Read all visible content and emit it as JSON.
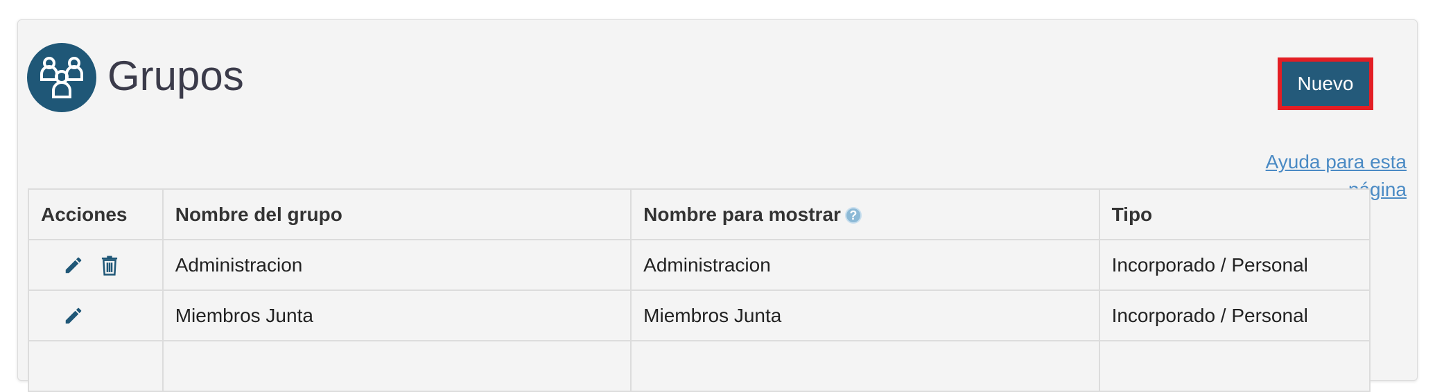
{
  "header": {
    "title": "Grupos",
    "icon": "group-icon",
    "accent": "#1f5777"
  },
  "toolbar": {
    "new_label": "Nuevo"
  },
  "help": {
    "link_label": "Ayuda para esta página"
  },
  "table": {
    "columns": {
      "actions": "Acciones",
      "group_name": "Nombre del grupo",
      "display_name": "Nombre para mostrar",
      "type": "Tipo"
    },
    "rows": [
      {
        "group_name": "Administracion",
        "display_name": "Administracion",
        "type": "Incorporado / Personal",
        "actions": [
          "edit-icon",
          "delete-icon"
        ]
      },
      {
        "group_name": "Miembros Junta",
        "display_name": "Miembros Junta",
        "type": "Incorporado / Personal",
        "actions": [
          "edit-icon"
        ]
      }
    ]
  },
  "colors": {
    "highlight_border": "#e31e24",
    "button_bg": "#245a7a",
    "link": "#4a8ac4"
  }
}
